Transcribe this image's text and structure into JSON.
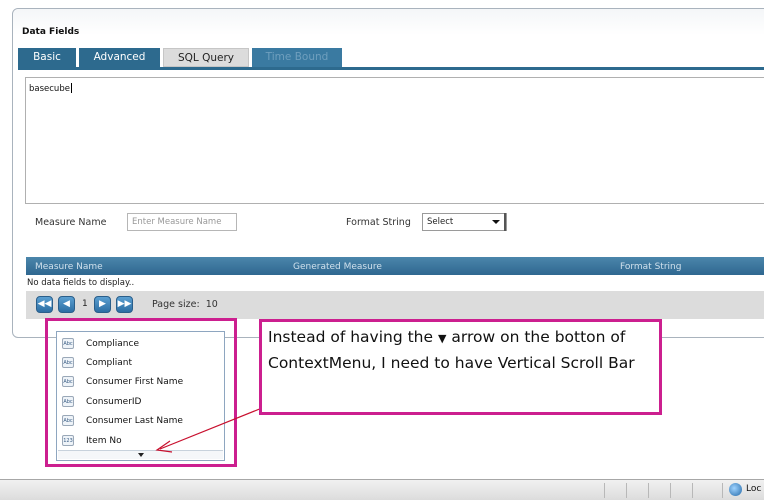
{
  "panel": {
    "title": "Data Fields"
  },
  "tabs": [
    {
      "label": "Basic"
    },
    {
      "label": "Advanced"
    },
    {
      "label": "SQL Query"
    },
    {
      "label": "Time Bound"
    }
  ],
  "sql_editor": {
    "value": "basecube"
  },
  "form": {
    "measure_name_label": "Measure Name",
    "measure_name_placeholder": "Enter Measure Name",
    "format_string_label": "Format String",
    "format_string_value": "Select"
  },
  "grid": {
    "columns": [
      "Measure Name",
      "Generated Measure",
      "Format String"
    ],
    "empty_text": "No data fields to display.."
  },
  "pager": {
    "current_page": "1",
    "page_size_label": "Page size:",
    "page_size": "10"
  },
  "context_menu": {
    "items": [
      {
        "label": "Compliance",
        "icon": "Abc"
      },
      {
        "label": "Compliant",
        "icon": "Abc"
      },
      {
        "label": "Consumer First Name",
        "icon": "Abc"
      },
      {
        "label": "ConsumerID",
        "icon": "Abc"
      },
      {
        "label": "Consumer Last Name",
        "icon": "Abc"
      },
      {
        "label": "Item No",
        "icon": "123"
      }
    ]
  },
  "annotation": {
    "text_before": "Instead of having the ",
    "text_after": " arrow on the botton of ContextMenu, I need to have Vertical Scroll Bar",
    "color": "#cc1f8f"
  },
  "statusbar": {
    "zone_text": "Loc"
  }
}
